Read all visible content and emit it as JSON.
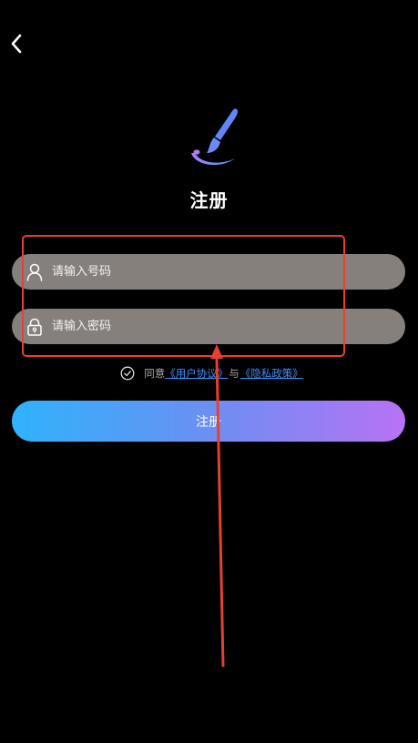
{
  "header": {
    "back_icon": "chevron-left-icon"
  },
  "logo": {
    "icon": "paintbrush-icon",
    "colors": [
      "#3aa0ff",
      "#8a6cf0",
      "#b07cf7"
    ]
  },
  "page": {
    "title": "注册"
  },
  "form": {
    "phone": {
      "icon": "user-icon",
      "placeholder": "请输入号码",
      "value": ""
    },
    "password": {
      "icon": "lock-icon",
      "placeholder": "请输入密码",
      "value": ""
    }
  },
  "agreement": {
    "checked": false,
    "prefix": "同意",
    "user_agreement": "《用户协议》",
    "connector": "与",
    "privacy_policy": "《隐私政策》",
    "link_color": "#3d8fff"
  },
  "submit": {
    "label": "注册",
    "gradient": [
      "#2fb3fb",
      "#6b8ff2",
      "#b872f5"
    ]
  },
  "annotation": {
    "color": "#e8402f"
  }
}
